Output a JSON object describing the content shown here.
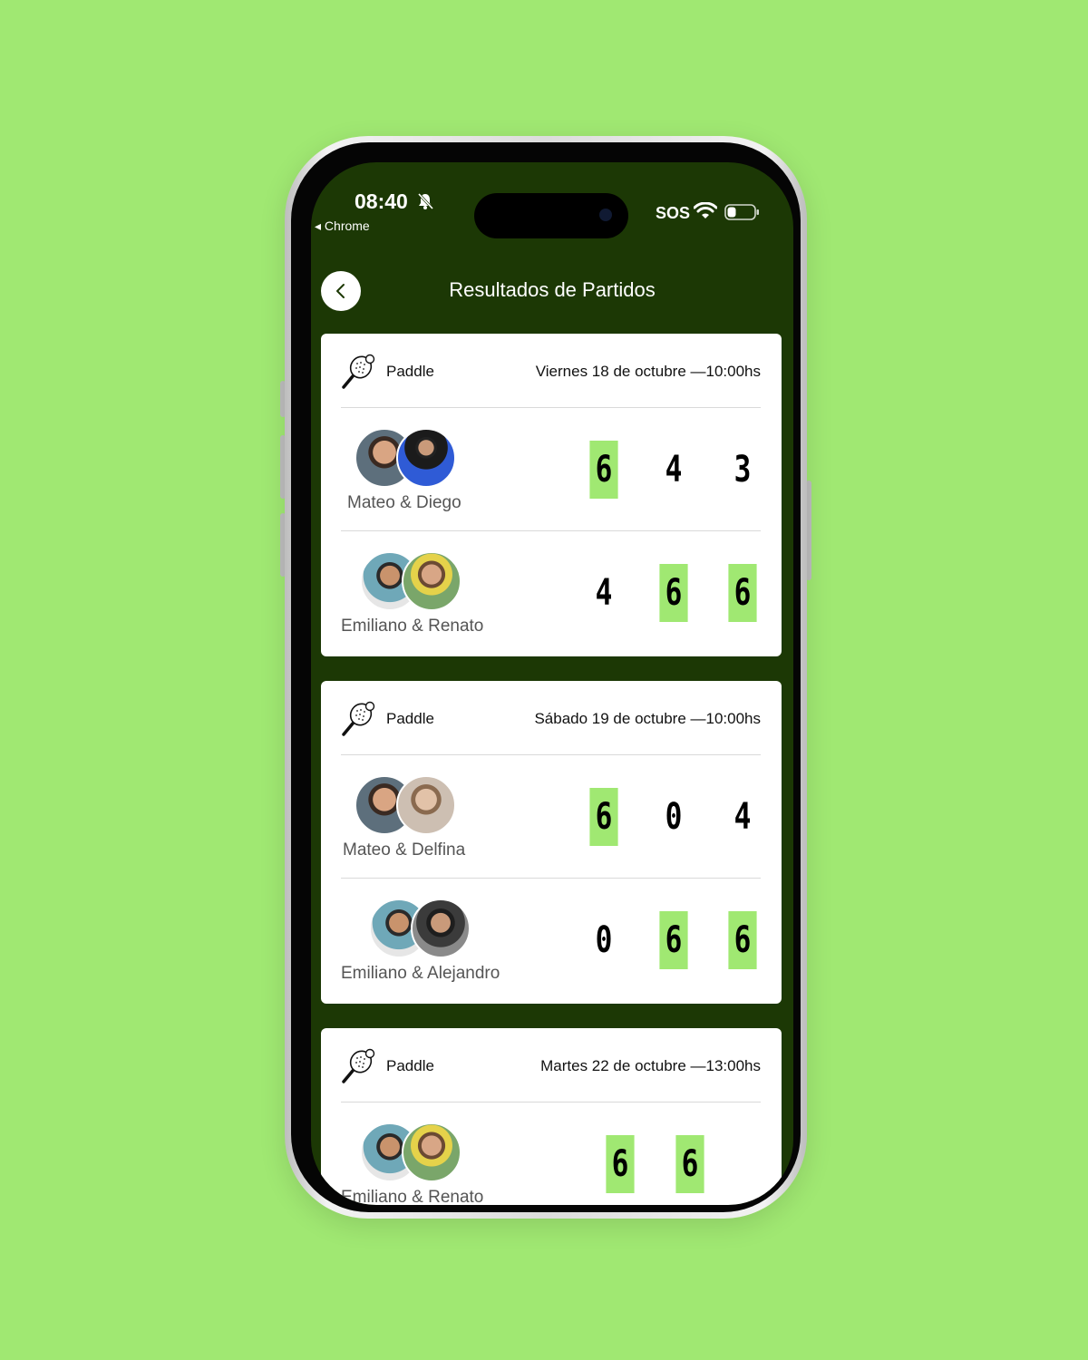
{
  "status_bar": {
    "time": "08:40",
    "back_app": "Chrome",
    "sos": "SOS"
  },
  "header": {
    "title": "Resultados de Partidos",
    "back_icon": "chevron-left-icon"
  },
  "colors": {
    "background": "#a0e872",
    "header": "#1c3805",
    "win_highlight": "#a0e872"
  },
  "matches": [
    {
      "sport": "Paddle",
      "date": "Viernes 18 de octubre —10:00hs",
      "teams": [
        {
          "name": "Mateo & Diego",
          "scores": [
            "6",
            "4",
            "3"
          ],
          "wins": [
            true,
            false,
            false
          ]
        },
        {
          "name": "Emiliano & Renato",
          "scores": [
            "4",
            "6",
            "6"
          ],
          "wins": [
            false,
            true,
            true
          ]
        }
      ]
    },
    {
      "sport": "Paddle",
      "date": "Sábado 19 de octubre —10:00hs",
      "teams": [
        {
          "name": "Mateo & Delfina",
          "scores": [
            "6",
            "0",
            "4"
          ],
          "wins": [
            true,
            false,
            false
          ]
        },
        {
          "name": "Emiliano & Alejandro",
          "scores": [
            "0",
            "6",
            "6"
          ],
          "wins": [
            false,
            true,
            true
          ]
        }
      ]
    },
    {
      "sport": "Paddle",
      "date": "Martes 22 de octubre —13:00hs",
      "teams": [
        {
          "name": "Emiliano & Renato",
          "scores": [
            "6",
            "6"
          ],
          "wins": [
            true,
            true
          ]
        }
      ]
    }
  ]
}
